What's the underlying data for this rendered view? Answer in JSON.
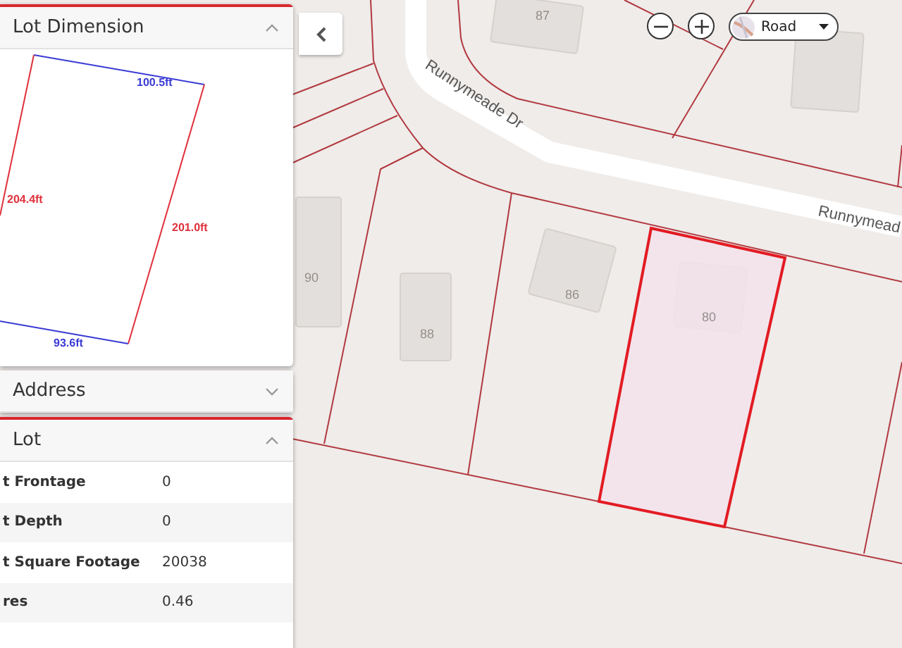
{
  "lot_dimension_panel": {
    "title": "Lot Dimension",
    "expanded": true,
    "sides": [
      {
        "label": "100.5ft",
        "color": "#3b3bd6"
      },
      {
        "label": "201.0ft",
        "color": "#e0303a"
      },
      {
        "label": "93.6ft",
        "color": "#3b3bd6"
      },
      {
        "label": "204.4ft",
        "color": "#e0303a"
      }
    ]
  },
  "address_panel": {
    "title": "Address",
    "expanded": false
  },
  "lot_panel": {
    "title": "Lot",
    "expanded": true,
    "rows": [
      {
        "label": "t Frontage",
        "value": "0"
      },
      {
        "label": "t Depth",
        "value": "0"
      },
      {
        "label": "t Square Footage",
        "value": "20038"
      },
      {
        "label": "res",
        "value": "0.46"
      }
    ]
  },
  "map": {
    "road_labels": [
      "Runnymeade Dr",
      "Runnymead"
    ],
    "house_numbers": [
      "87",
      "90",
      "88",
      "86",
      "80"
    ],
    "layer_select": {
      "value": "Road"
    }
  }
}
